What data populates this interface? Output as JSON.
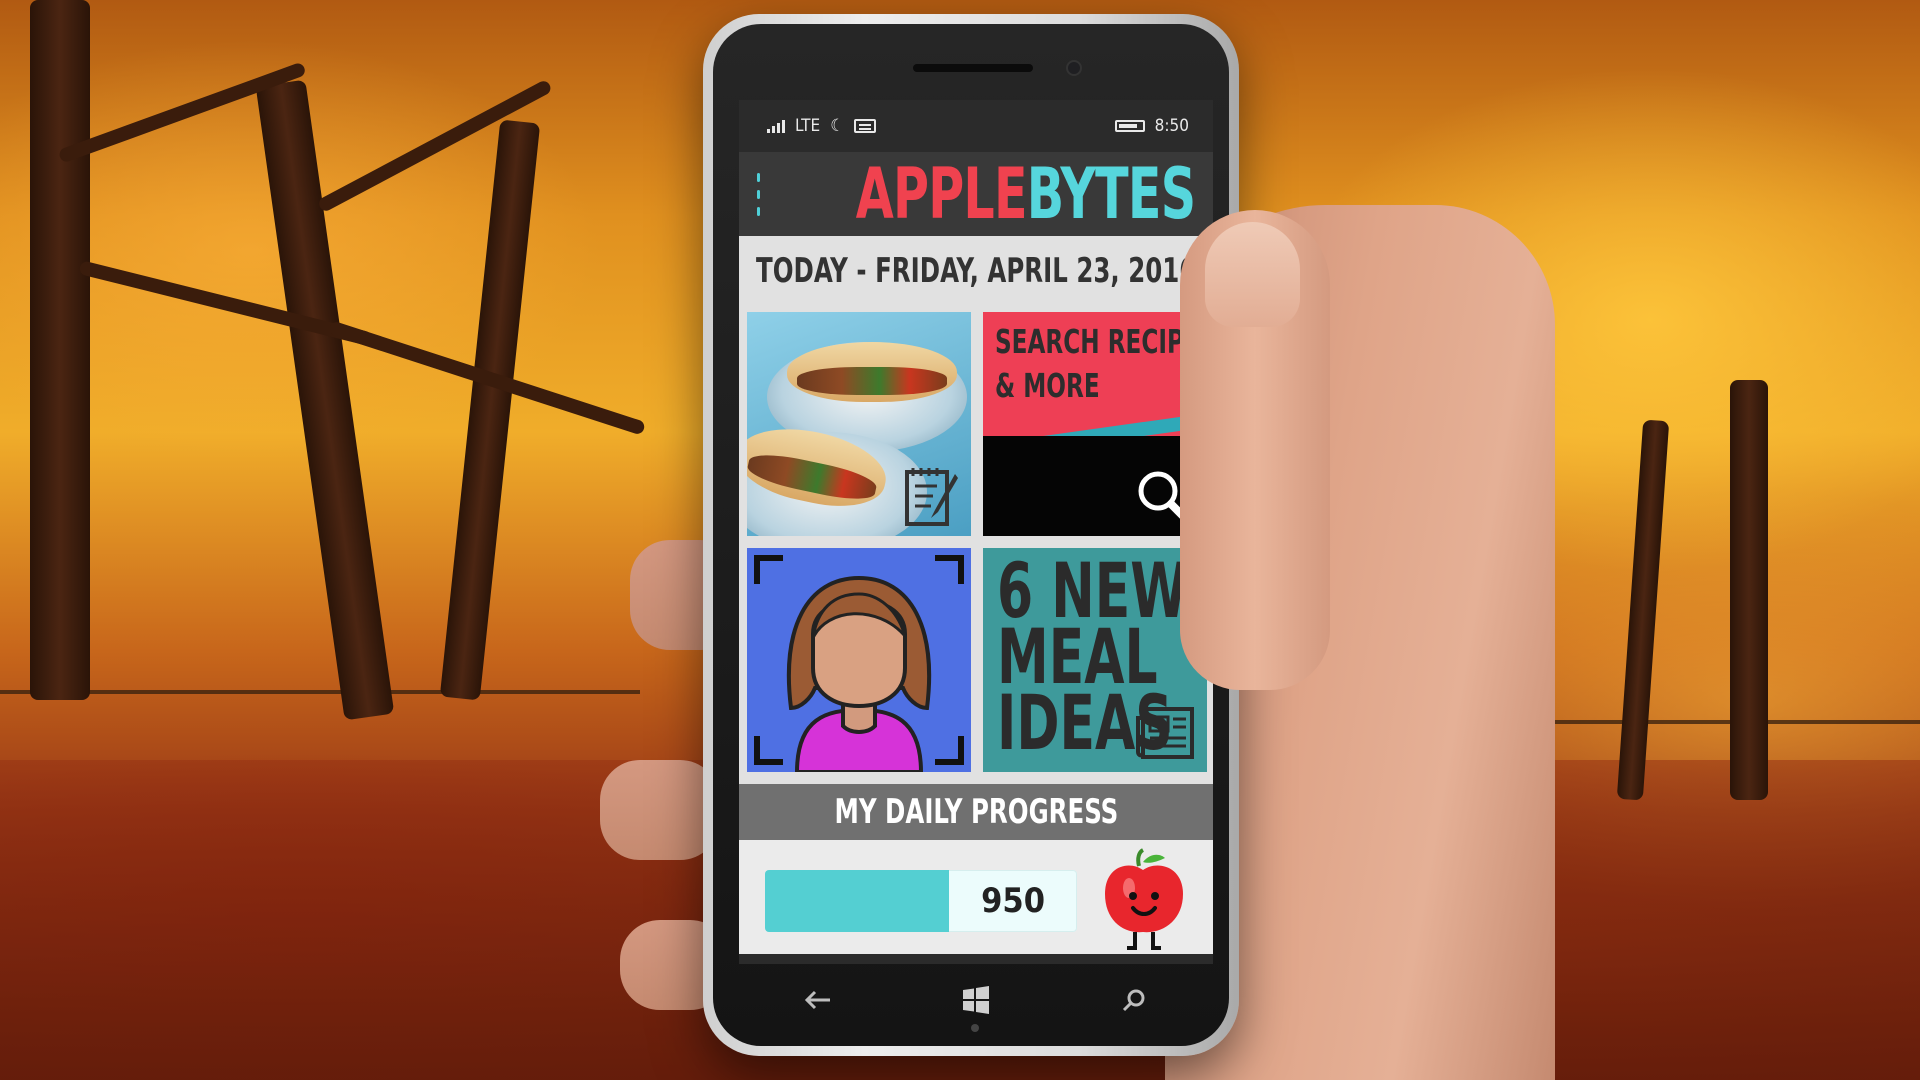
{
  "status": {
    "network": "LTE",
    "time": "8:50"
  },
  "app": {
    "brand_part1": "APPLE",
    "brand_part2": "BYTES",
    "date": "TODAY - FRIDAY, APRIL 23, 2016"
  },
  "tiles": {
    "search": {
      "line1": "SEARCH RECIPES",
      "line2": "& MORE"
    },
    "ideas": {
      "line1": "6 NEW",
      "line2": "MEAL",
      "line3": "IDEAS"
    }
  },
  "progress": {
    "title": "MY DAILY PROGRESS",
    "value": "950",
    "fill_fraction": 0.59
  },
  "colors": {
    "accent_red": "#f0424f",
    "accent_cyan": "#56d6dc",
    "progress_fill": "#54cfd2"
  },
  "icons": {
    "menu": "hamburger-menu-icon",
    "meal_log": "notepad-pencil-icon",
    "search": "magnifier-icon",
    "profile": "person-avatar-icon",
    "news": "newspaper-icon",
    "mascot": "apple-mascot-icon",
    "back": "back-arrow-icon",
    "home": "windows-logo-icon",
    "nav_search": "search-icon"
  }
}
